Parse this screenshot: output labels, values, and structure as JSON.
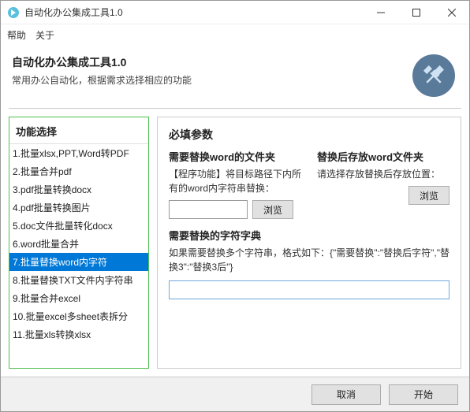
{
  "window": {
    "title": "自动化办公集成工具1.0"
  },
  "menu": {
    "help": "帮助",
    "about": "关于"
  },
  "header": {
    "title": "自动化办公集成工具1.0",
    "subtitle": "常用办公自动化，根据需求选择相应的功能"
  },
  "sidebar": {
    "title": "功能选择",
    "items": [
      "1.批量xlsx,PPT,Word转PDF",
      "2.批量合并pdf",
      "3.pdf批量转换docx",
      "4.pdf批量转换图片",
      "5.doc文件批量转化docx",
      "6.word批量合并",
      "7.批量替换word内字符",
      "8.批量替换TXT文件内字符串",
      "9.批量合并excel",
      "10.批量excel多sheet表拆分",
      "11.批量xls转换xlsx"
    ],
    "selected": 6
  },
  "main": {
    "required": "必填参数",
    "left": {
      "label": "需要替换word的文件夹",
      "desc": "【程序功能】将目标路径下内所有的word内字符串替换：",
      "browse": "浏览"
    },
    "right": {
      "label": "替换后存放word文件夹",
      "desc": "请选择存放替换后存放位置：",
      "browse": "浏览"
    },
    "dict": {
      "label": "需要替换的字符字典",
      "desc": "如果需要替换多个字符串，格式如下：{\"需要替换\":\"替换后字符\",\"替换3\":\"替换3后\"}"
    }
  },
  "footer": {
    "cancel": "取消",
    "start": "开始"
  }
}
